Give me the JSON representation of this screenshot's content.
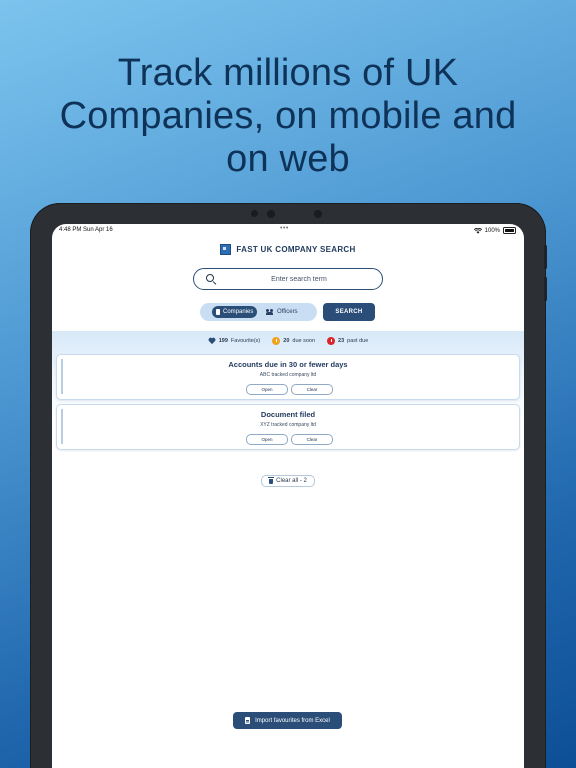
{
  "headline": [
    "Track millions of UK",
    "Companies, on mobile and",
    "on web"
  ],
  "status_bar": {
    "time_date": "4:48 PM   Sun Apr 16",
    "multitask_dots": "•••",
    "battery_text": "100%"
  },
  "app": {
    "title": "FAST UK COMPANY SEARCH",
    "search_placeholder": "Enter search term",
    "segments": {
      "companies": "Companies",
      "officers": "Officers",
      "selected": "Companies"
    },
    "search_button": "SEARCH"
  },
  "stats": {
    "favourites": {
      "count": "199",
      "label": "Favourite(s)"
    },
    "due_soon": {
      "count": "20",
      "label": "due soon",
      "color": "#f0a21a"
    },
    "past_due": {
      "count": "23",
      "label": "past due",
      "color": "#d9262a"
    }
  },
  "cards": [
    {
      "title": "Accounts due in 30 or fewer days",
      "subtitle": "ABC tracked company ltd",
      "open": "Open",
      "clear": "Clear"
    },
    {
      "title": "Document filed",
      "subtitle": "XYZ tracked company ltd",
      "open": "Open",
      "clear": "Clear"
    }
  ],
  "clear_all": "Clear all -  2",
  "import_button": "Import favourites from Excel",
  "colors": {
    "primary": "#2a4e78",
    "bg_gradient_start": "#7cc4ee",
    "bg_gradient_end": "#0d4f97"
  }
}
